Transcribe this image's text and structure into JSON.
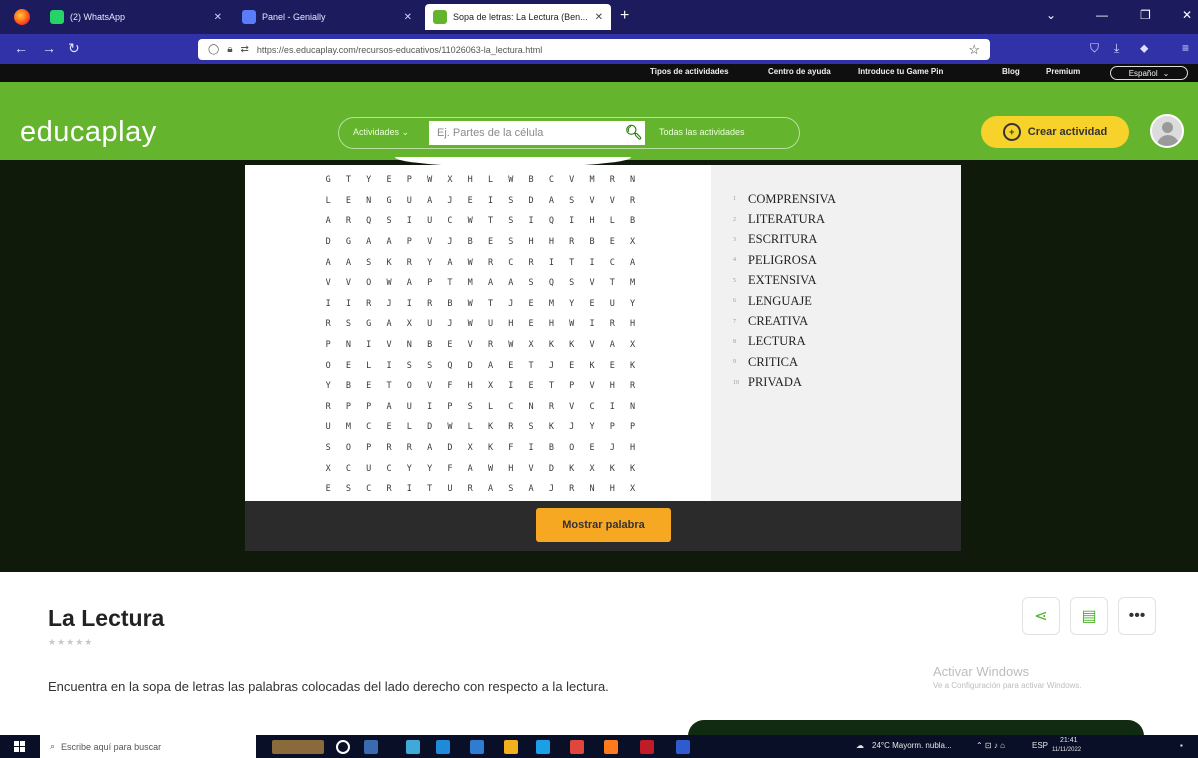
{
  "browser": {
    "tabs": [
      {
        "label": "(2) WhatsApp",
        "color": "#25d366"
      },
      {
        "label": "Panel - Genially",
        "color": "#5b7cfa"
      },
      {
        "label": "Sopa de letras: La Lectura (Ben...",
        "color": "#64b52d"
      }
    ],
    "url": "https://es.educaplay.com/recursos-educativos/11026063-la_lectura.html"
  },
  "top_links": [
    "Tipos de actividades",
    "Centro de ayuda",
    "Introduce tu Game Pin",
    "Blog",
    "Premium"
  ],
  "language": "Español",
  "header": {
    "logo": "educaplay",
    "activities_label": "Actividades",
    "search_placeholder": "Ej. Partes de la célula",
    "all_activities": "Todas las actividades",
    "create_label": "Crear actividad"
  },
  "grid_rows": [
    "GTYEPWXHLWBCVMRN",
    "LENGUAJEISDASVVR",
    "ARQSIUCWTSIQIHLB",
    "DGAAPVJBESHHRBEX",
    "AASKRYAWRCRITICA",
    "VVOWAPTMAASQSVTM",
    "IIRJIRBWTJEMYEUY",
    "RSGAXUJWUHEHWIRH",
    "PNIVNBEVRWXKKVAX",
    "OELISSQDAETJEKEK",
    "YBETOVFHXIETPVHR",
    "RPPAUIPSLCNRVCIN",
    "UMCELDWLKRSKJYPP",
    "SOPRRADXKFIBOEJH",
    "XCUCYYFAWHVDKXKK",
    "ESCRITURASAJRNHX"
  ],
  "words": [
    {
      "num": "1",
      "text": "COMPRENSIVA"
    },
    {
      "num": "2",
      "text": "LITERATURA"
    },
    {
      "num": "3",
      "text": "ESCRITURA"
    },
    {
      "num": "4",
      "text": "PELIGROSA"
    },
    {
      "num": "5",
      "text": "EXTENSIVA"
    },
    {
      "num": "6",
      "text": "LENGUAJE"
    },
    {
      "num": "7",
      "text": "CREATIVA"
    },
    {
      "num": "8",
      "text": "LECTURA"
    },
    {
      "num": "9",
      "text": "CRITICA"
    },
    {
      "num": "10",
      "text": "PRIVADA"
    }
  ],
  "show_word_button": "Mostrar palabra",
  "activity": {
    "title": "La Lectura",
    "rating_stars": 0,
    "description": "Encuentra en la sopa de letras las palabras colocadas del lado derecho con respecto a la lectura."
  },
  "activate_windows": {
    "title": "Activar Windows",
    "subtitle": "Ve a Configuración para activar Windows."
  },
  "taskbar": {
    "search_placeholder": "Escribe aquí para buscar",
    "weather": "24°C Mayorm. nubla...",
    "lang": "ESP",
    "time": "21:41",
    "date": "11/11/2022"
  }
}
